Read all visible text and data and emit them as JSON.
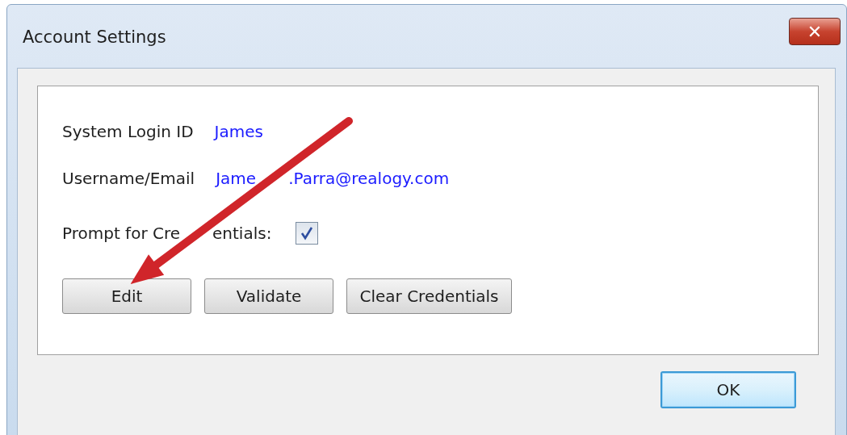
{
  "window": {
    "title": "Account Settings",
    "close_label": "✕"
  },
  "fields": [
    {
      "label": "System Login ID",
      "value_parts": [
        "James"
      ]
    },
    {
      "label": "Username/Email",
      "value_parts": [
        "Jame",
        ".Parra@realogy.com"
      ]
    }
  ],
  "prompt": {
    "label_parts": [
      "Prompt for Cre",
      "entials:"
    ],
    "checked": true
  },
  "buttons": [
    "Edit",
    "Validate",
    "Clear Credentials"
  ],
  "ok": "OK"
}
